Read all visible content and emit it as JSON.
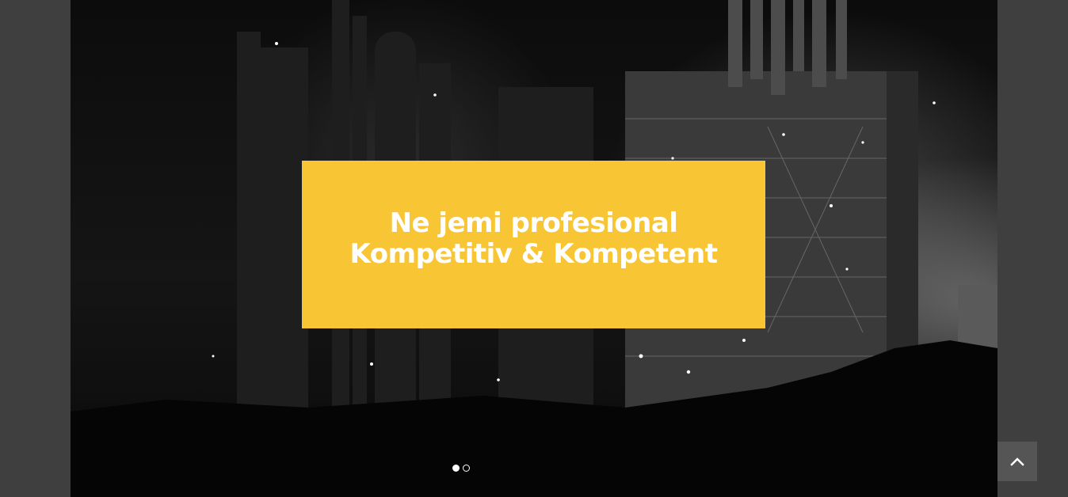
{
  "hero": {
    "headline_line1": "Ne jemi profesional",
    "headline_line2": "Kompetitiv & Kompetent",
    "accent_color": "#f8c535",
    "slides_total": 2,
    "active_slide": 1
  },
  "scroll_top": {
    "icon": "chevron-up-icon"
  }
}
